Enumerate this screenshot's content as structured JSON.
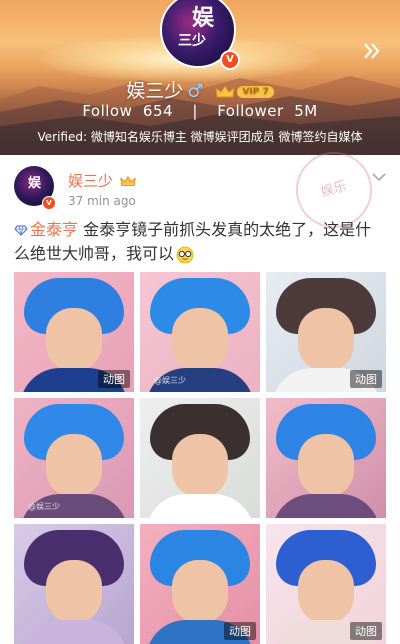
{
  "profile": {
    "avatar_text_1": "娱",
    "avatar_text_2": "三少",
    "avatar_badge": "V",
    "name": "娱三少",
    "gender_symbol": "♂",
    "vip_label": "VIP 7",
    "follow_label": "Follow",
    "follow_count": "654",
    "follower_label": "Follower",
    "follower_count": "5M",
    "verified_text": "Verified: 微博知名娱乐博主 微博娱评团成员 微博签约自媒体"
  },
  "post": {
    "author": "娱三少",
    "time": "37 min ago",
    "stamp_text": "娱乐",
    "topic": "金泰亨",
    "text": " 金泰亨镜子前抓头发真的太绝了，这是什么绝世大帅哥，我可以",
    "media": [
      {
        "gif_label": "动图",
        "watermark": ""
      },
      {
        "gif_label": "",
        "watermark": "@娱三少"
      },
      {
        "gif_label": "动图",
        "watermark": ""
      },
      {
        "gif_label": "",
        "watermark": "@娱三少"
      },
      {
        "gif_label": "",
        "watermark": ""
      },
      {
        "gif_label": "",
        "watermark": ""
      },
      {
        "gif_label": "",
        "watermark": ""
      },
      {
        "gif_label": "动图",
        "watermark": ""
      },
      {
        "gif_label": "动图",
        "watermark": ""
      }
    ]
  },
  "icons": {
    "header_chevron": "double-chevron-right-icon",
    "verified_badge": "v-badge-icon",
    "crown": "crown-icon",
    "more": "chevron-down-icon",
    "topic": "diamond-icon",
    "emoji": "glasses-emoji-icon"
  },
  "colors": {
    "accent": "#eb7350",
    "verified_badge": "#f24c1f",
    "secondary_text": "#939393"
  }
}
